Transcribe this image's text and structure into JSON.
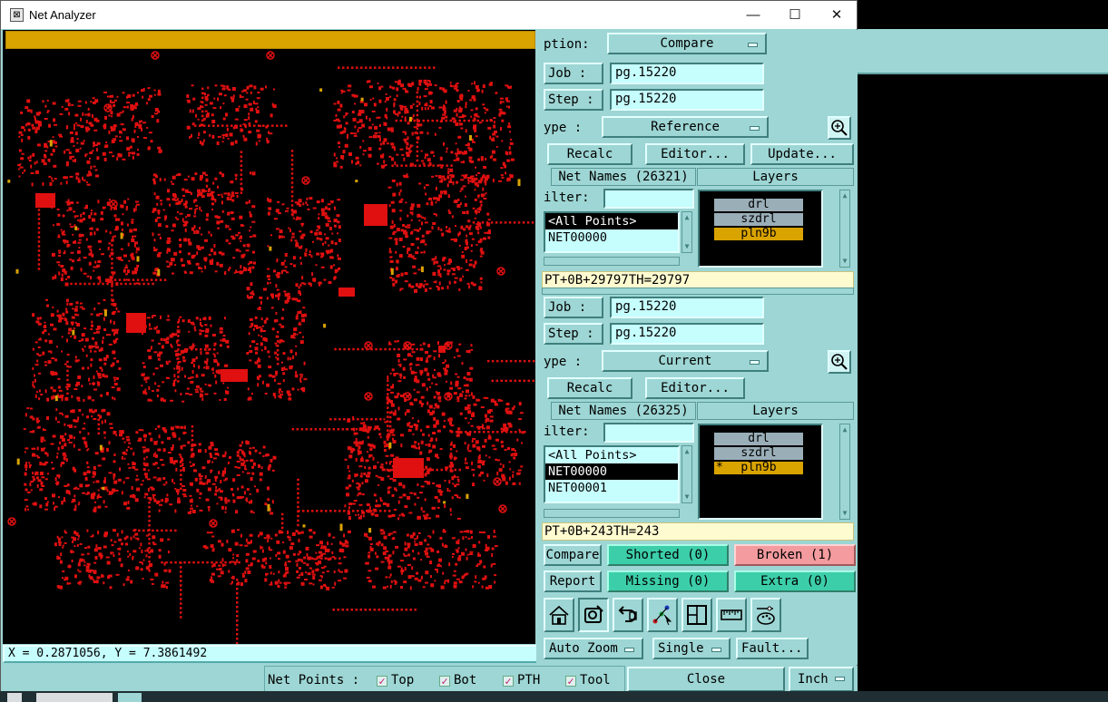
{
  "window": {
    "title": "Net Analyzer",
    "minimize": "—",
    "maximize": "☐",
    "close": "✕"
  },
  "coords": "X = 0.2871056, Y = 7.3861492",
  "net_points": {
    "label": "Net Points :",
    "options": [
      {
        "label": "Top",
        "checked": true
      },
      {
        "label": "Bot",
        "checked": true
      },
      {
        "label": "PTH",
        "checked": true
      },
      {
        "label": "Tool",
        "checked": true
      }
    ],
    "checkmark": "✓"
  },
  "panel": {
    "option_label": "ption:",
    "option_value": "Compare",
    "ref": {
      "job_label": "Job  :",
      "job_value": "pg.15220",
      "step_label": "Step :",
      "step_value": "pg.15220",
      "type_label": "ype :",
      "type_value": "Reference",
      "recalc": "Recalc",
      "editor": "Editor...",
      "update": "Update...",
      "net_names": "Net Names (26321)",
      "layers_header": "Layers",
      "filter_label": "ilter:",
      "filter_value": "",
      "nets": [
        "<All Points>",
        "NET00000"
      ],
      "layers": [
        "drl",
        "szdrl",
        "pln9b"
      ],
      "info": "PT+0B+29797TH=29797"
    },
    "cur": {
      "job_label": "Job  :",
      "job_value": "pg.15220",
      "step_label": "Step :",
      "step_value": "pg.15220",
      "type_label": "ype :",
      "type_value": "Current",
      "recalc": "Recalc",
      "editor": "Editor...",
      "net_names": "Net Names (26325)",
      "layers_header": "Layers",
      "filter_label": "ilter:",
      "filter_value": "",
      "nets": [
        "<All Points>",
        "NET00000",
        "NET00001"
      ],
      "layers": [
        "drl",
        "szdrl",
        "pln9b"
      ],
      "active_mark": "*",
      "info": "PT+0B+243TH=243"
    },
    "compare": "Compare",
    "report": "Report",
    "shorted": "Shorted (0)",
    "broken": "Broken (1)",
    "missing": "Missing (0)",
    "extra": "Extra (0)",
    "auto_zoom": "Auto Zoom",
    "single": "Single",
    "fault": "Fault...",
    "close": "Close",
    "units": "Inch"
  },
  "colors": {
    "panel": "#9dd6d4",
    "field": "#c6fdfd",
    "accent": "#d9a300",
    "board": "#e01010",
    "ok": "#3ccea9",
    "bad": "#f39b9e"
  }
}
